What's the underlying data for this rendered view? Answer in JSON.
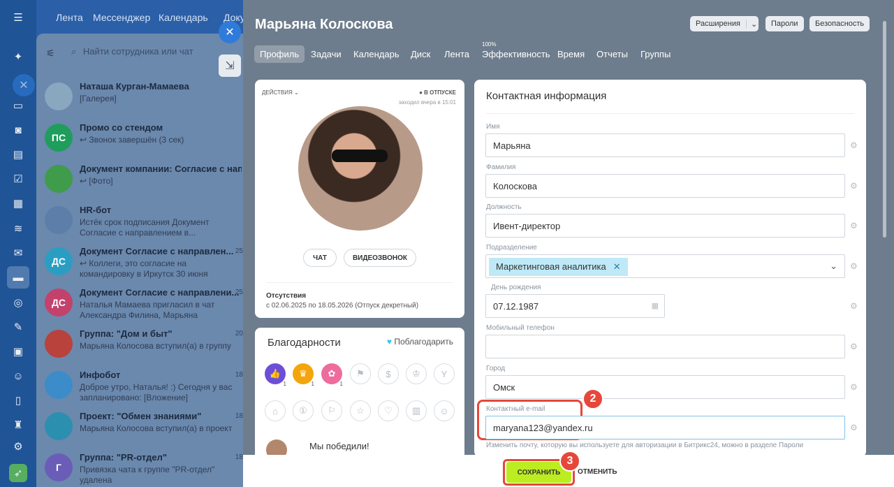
{
  "topnav": {
    "feed": "Лента",
    "messenger": "Мессенджер",
    "calendar": "Календарь",
    "docs": "Доку"
  },
  "chat": {
    "search_placeholder": "Найти сотрудника или чат",
    "items": [
      {
        "name": "Наташа Курган-Мамаева",
        "msg": "[Галерея]",
        "time": "",
        "initials": "",
        "color": "#8aa7c0"
      },
      {
        "name": "Промо со стендом",
        "msg": "↩ Звонок завершён (3 сек)",
        "time": "",
        "initials": "ПС",
        "color": "#1f9d5d"
      },
      {
        "name": "Документ компании: Согласие с нап...",
        "msg": "↩ [Фото]",
        "time": "",
        "initials": "",
        "color": "#3e9c4b"
      },
      {
        "name": "HR-бот",
        "msg": "Истёк срок подписания Документ Согласие с направлением в...",
        "time": "",
        "initials": "",
        "color": "#5c7ea8"
      },
      {
        "name": "Документ Согласие с направлен...",
        "msg": "↩ Коллеги, это согласие на командировку в Иркутск 30 июня",
        "time": "25",
        "initials": "ДС",
        "color": "#2a9ec2"
      },
      {
        "name": "Документ Согласие с направлени...",
        "msg": "Наталья Мамаева пригласил в чат Александра Филина, Марьяна Колосков...",
        "time": "25",
        "initials": "ДС",
        "color": "#c2426c"
      },
      {
        "name": "Группа: \"Дом и быт\"",
        "msg": "Марьяна Колосова вступил(а) в группу",
        "time": "20",
        "initials": "",
        "color": "#b9423c"
      },
      {
        "name": "Инфобот",
        "msg": "Доброе утро, Наталья! :) Сегодня у вас запланировано: [Вложение]",
        "time": "18",
        "initials": "",
        "color": "#3b8cc8"
      },
      {
        "name": "Проект: \"Обмен знаниями\"",
        "msg": "Марьяна Колосова вступил(а) в проект",
        "time": "18",
        "initials": "",
        "color": "#2b8fb0"
      },
      {
        "name": "Группа: \"PR-отдел\"",
        "msg": "Привязка чата к группе \"PR-отдел\" удалена",
        "time": "18",
        "initials": "Г",
        "color": "#6a5db8"
      }
    ]
  },
  "profile": {
    "name": "Марьяна Колоскова",
    "tabs": [
      "Профиль",
      "Задачи",
      "Календарь",
      "Диск",
      "Лента",
      "Эффективность",
      "Время",
      "Отчеты",
      "Группы"
    ],
    "efficiency_badge": "100%",
    "header_buttons": {
      "extensions": "Расширения",
      "passwords": "Пароли",
      "security": "Безопасность"
    },
    "actions": "ДЕЙСТВИЯ",
    "status": "В ОТПУСКЕ",
    "last_seen": "заходил вчера в 15:01",
    "btn_chat": "ЧАТ",
    "btn_video": "ВИДЕОЗВОНОК",
    "absence_title": "Отсутствия",
    "absence_text": "с 02.06.2025 по 18.05.2026 (Отпуск декретный)",
    "thanks_title": "Благодарности",
    "thanks_link": "Поблагодарить",
    "post_text": "Мы победили!"
  },
  "contact": {
    "title": "Контактная информация",
    "first_name_label": "Имя",
    "first_name": "Марьяна",
    "last_name_label": "Фамилия",
    "last_name": "Колоскова",
    "position_label": "Должность",
    "position": "Ивент-директор",
    "dept_label": "Подразделение",
    "dept": "Маркетинговая аналитика",
    "birthday_label": "День рождения",
    "birthday": "07.12.1987",
    "phone_label": "Мобильный телефон",
    "phone": "",
    "city_label": "Город",
    "city": "Омск",
    "email_label": "Контактный e-mail",
    "email": "maryana123@yandex.ru",
    "email_hint": "Изменить почту, которую вы используете для авторизации в Битрикс24, можно в разделе Пароли"
  },
  "footer": {
    "save": "СОХРАНИТЬ",
    "cancel": "ОТМЕНИТЬ"
  },
  "markers": {
    "m2": "2",
    "m3": "3"
  },
  "colors": {
    "accent": "#bbed21",
    "marker": "#e5483a",
    "rail": "#1f5497"
  }
}
